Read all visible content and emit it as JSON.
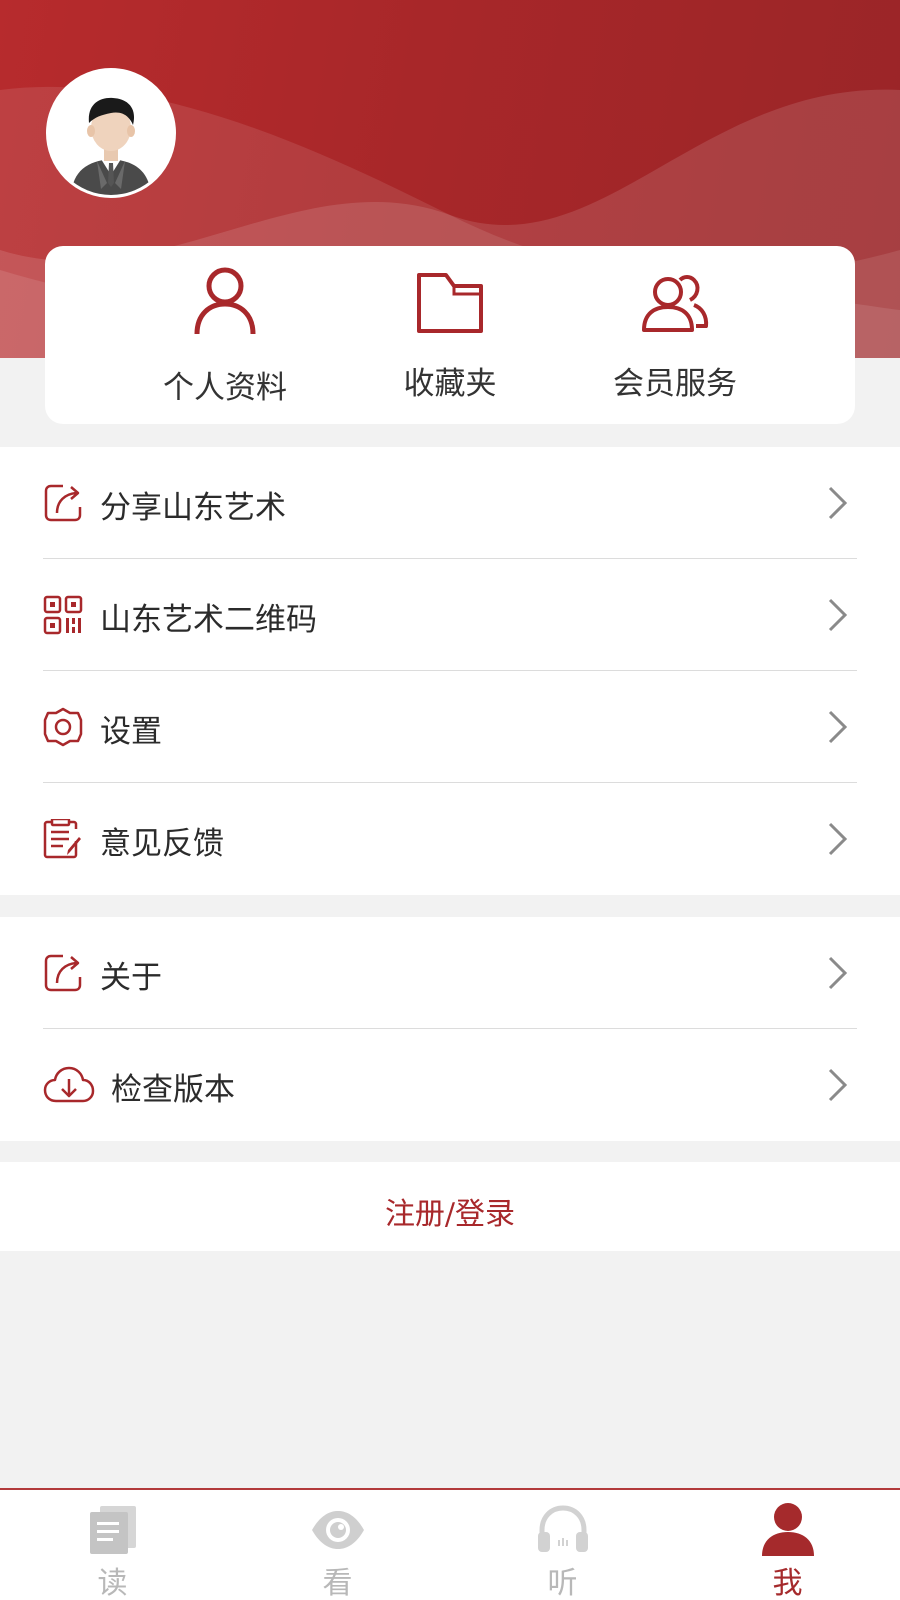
{
  "colors": {
    "brand": "#a8282b",
    "header_bg": "#a82729",
    "page_bg": "#f2f2f2",
    "tab_inactive": "#b8b8b8"
  },
  "profile": {
    "avatar_icon": "default-male-avatar"
  },
  "quick_actions": [
    {
      "label": "个人资料",
      "icon": "person-icon"
    },
    {
      "label": "收藏夹",
      "icon": "folder-icon"
    },
    {
      "label": "会员服务",
      "icon": "members-icon"
    }
  ],
  "menu_group_1": [
    {
      "label": "分享山东艺术",
      "icon": "share-icon"
    },
    {
      "label": "山东艺术二维码",
      "icon": "qr-code-icon"
    },
    {
      "label": "设置",
      "icon": "gear-icon"
    },
    {
      "label": "意见反馈",
      "icon": "feedback-icon"
    }
  ],
  "menu_group_2": [
    {
      "label": "关于",
      "icon": "share-icon"
    },
    {
      "label": "检查版本",
      "icon": "cloud-download-icon"
    }
  ],
  "login": {
    "label": "注册/登录"
  },
  "tabbar": [
    {
      "label": "读",
      "icon": "read-icon",
      "active": false
    },
    {
      "label": "看",
      "icon": "eye-icon",
      "active": false
    },
    {
      "label": "听",
      "icon": "headphones-icon",
      "active": false
    },
    {
      "label": "我",
      "icon": "user-icon",
      "active": true
    }
  ]
}
